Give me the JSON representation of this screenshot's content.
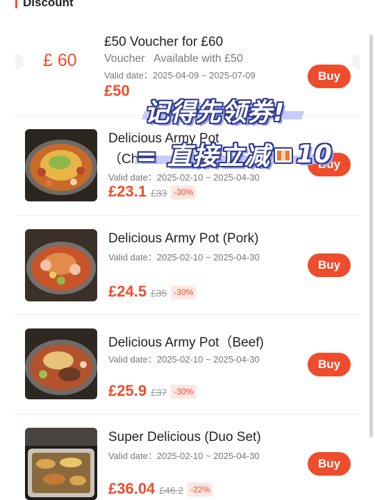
{
  "header": {
    "title": "Discount"
  },
  "voucher": {
    "amount_label": "£ 60",
    "title": "£50 Voucher for £60",
    "subtitle": "Voucher   Available with £50",
    "valid": "Valid date：2025-04-09 ~ 2025-07-09",
    "price": "£50",
    "buy_label": "Buy"
  },
  "products": [
    {
      "title_line1": "Delicious Army Pot",
      "title_line2": "（Ch",
      "valid": "Valid date：2025-02-10 ~ 2025-04-30",
      "price": "£23.1",
      "old_price": "£33",
      "discount": "-30%",
      "buy_label": "Buy"
    },
    {
      "title": "Delicious Army Pot (Pork)",
      "valid": "Valid date：2025-02-10 ~ 2025-04-30",
      "price": "£24.5",
      "old_price": "£35",
      "discount": "-30%",
      "buy_label": "Buy"
    },
    {
      "title": "Delicious Army Pot（Beef)",
      "valid": "Valid date：2025-02-10 ~ 2025-04-30",
      "price": "£25.9",
      "old_price": "£37",
      "discount": "-30%",
      "buy_label": "Buy"
    },
    {
      "title": "Super Delicious (Duo Set)",
      "valid": "Valid date：2025-02-10 ~ 2025-04-30",
      "price": "£36.04",
      "old_price": "£46.2",
      "discount": "-22%",
      "buy_label": "Buy"
    }
  ],
  "overlay": {
    "line1": "记得先领券!",
    "line2_prefix": "= 直接立减",
    "line2_suffix": "10",
    "money_icon": "money-bill-icon"
  },
  "colors": {
    "accent": "#ee4d2d",
    "overlay_outline": "#2f3a8f",
    "overlay_stripe": "#c7cbf6"
  }
}
